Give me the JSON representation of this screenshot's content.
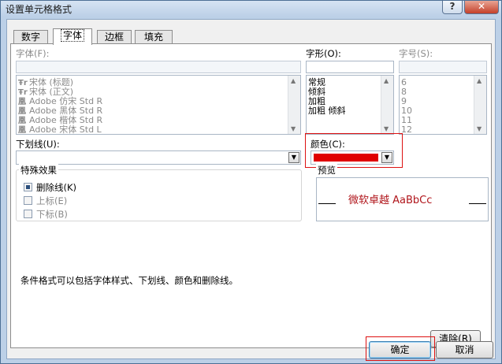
{
  "window": {
    "title": "设置单元格格式",
    "help_label": "?",
    "close_label": "✕"
  },
  "tabs": [
    {
      "label": "数字"
    },
    {
      "label": "字体",
      "active": true
    },
    {
      "label": "边框"
    },
    {
      "label": "填充"
    }
  ],
  "font": {
    "label": "字体(F):",
    "value": "",
    "items": [
      {
        "icon": "truetype-font-icon",
        "glyph": "Ŧr",
        "label": "宋体 (标题)"
      },
      {
        "icon": "truetype-font-icon",
        "glyph": "Ŧr",
        "label": "宋体 (正文)"
      },
      {
        "icon": "opentype-font-icon",
        "glyph": "凰",
        "label": "Adobe 仿宋 Std R"
      },
      {
        "icon": "opentype-font-icon",
        "glyph": "凰",
        "label": "Adobe 黑体 Std R"
      },
      {
        "icon": "opentype-font-icon",
        "glyph": "凰",
        "label": "Adobe 楷体 Std R"
      },
      {
        "icon": "opentype-font-icon",
        "glyph": "凰",
        "label": "Adobe 宋体 Std L"
      }
    ]
  },
  "style": {
    "label": "字形(O):",
    "value": "",
    "items": [
      "常规",
      "倾斜",
      "加粗",
      "加粗 倾斜"
    ]
  },
  "size": {
    "label": "字号(S):",
    "value": "",
    "items": [
      "6",
      "8",
      "9",
      "10",
      "11",
      "12"
    ]
  },
  "underline": {
    "label": "下划线(U):",
    "value": ""
  },
  "color": {
    "label": "颜色(C):",
    "value_hex": "#e00000"
  },
  "effects": {
    "title": "特殊效果",
    "items": [
      {
        "label": "删除线(K)",
        "checked": true,
        "enabled": true
      },
      {
        "label": "上标(E)",
        "checked": false,
        "enabled": false
      },
      {
        "label": "下标(B)",
        "checked": false,
        "enabled": false
      }
    ]
  },
  "preview": {
    "title": "预览",
    "sample": "微软卓越  AaBbCc",
    "text_color": "#b0151b"
  },
  "info_text": "条件格式可以包括字体样式、下划线、颜色和删除线。",
  "buttons": {
    "clear": "清除(R)",
    "ok": "确定",
    "cancel": "取消"
  },
  "highlight_color": "#dd1111"
}
